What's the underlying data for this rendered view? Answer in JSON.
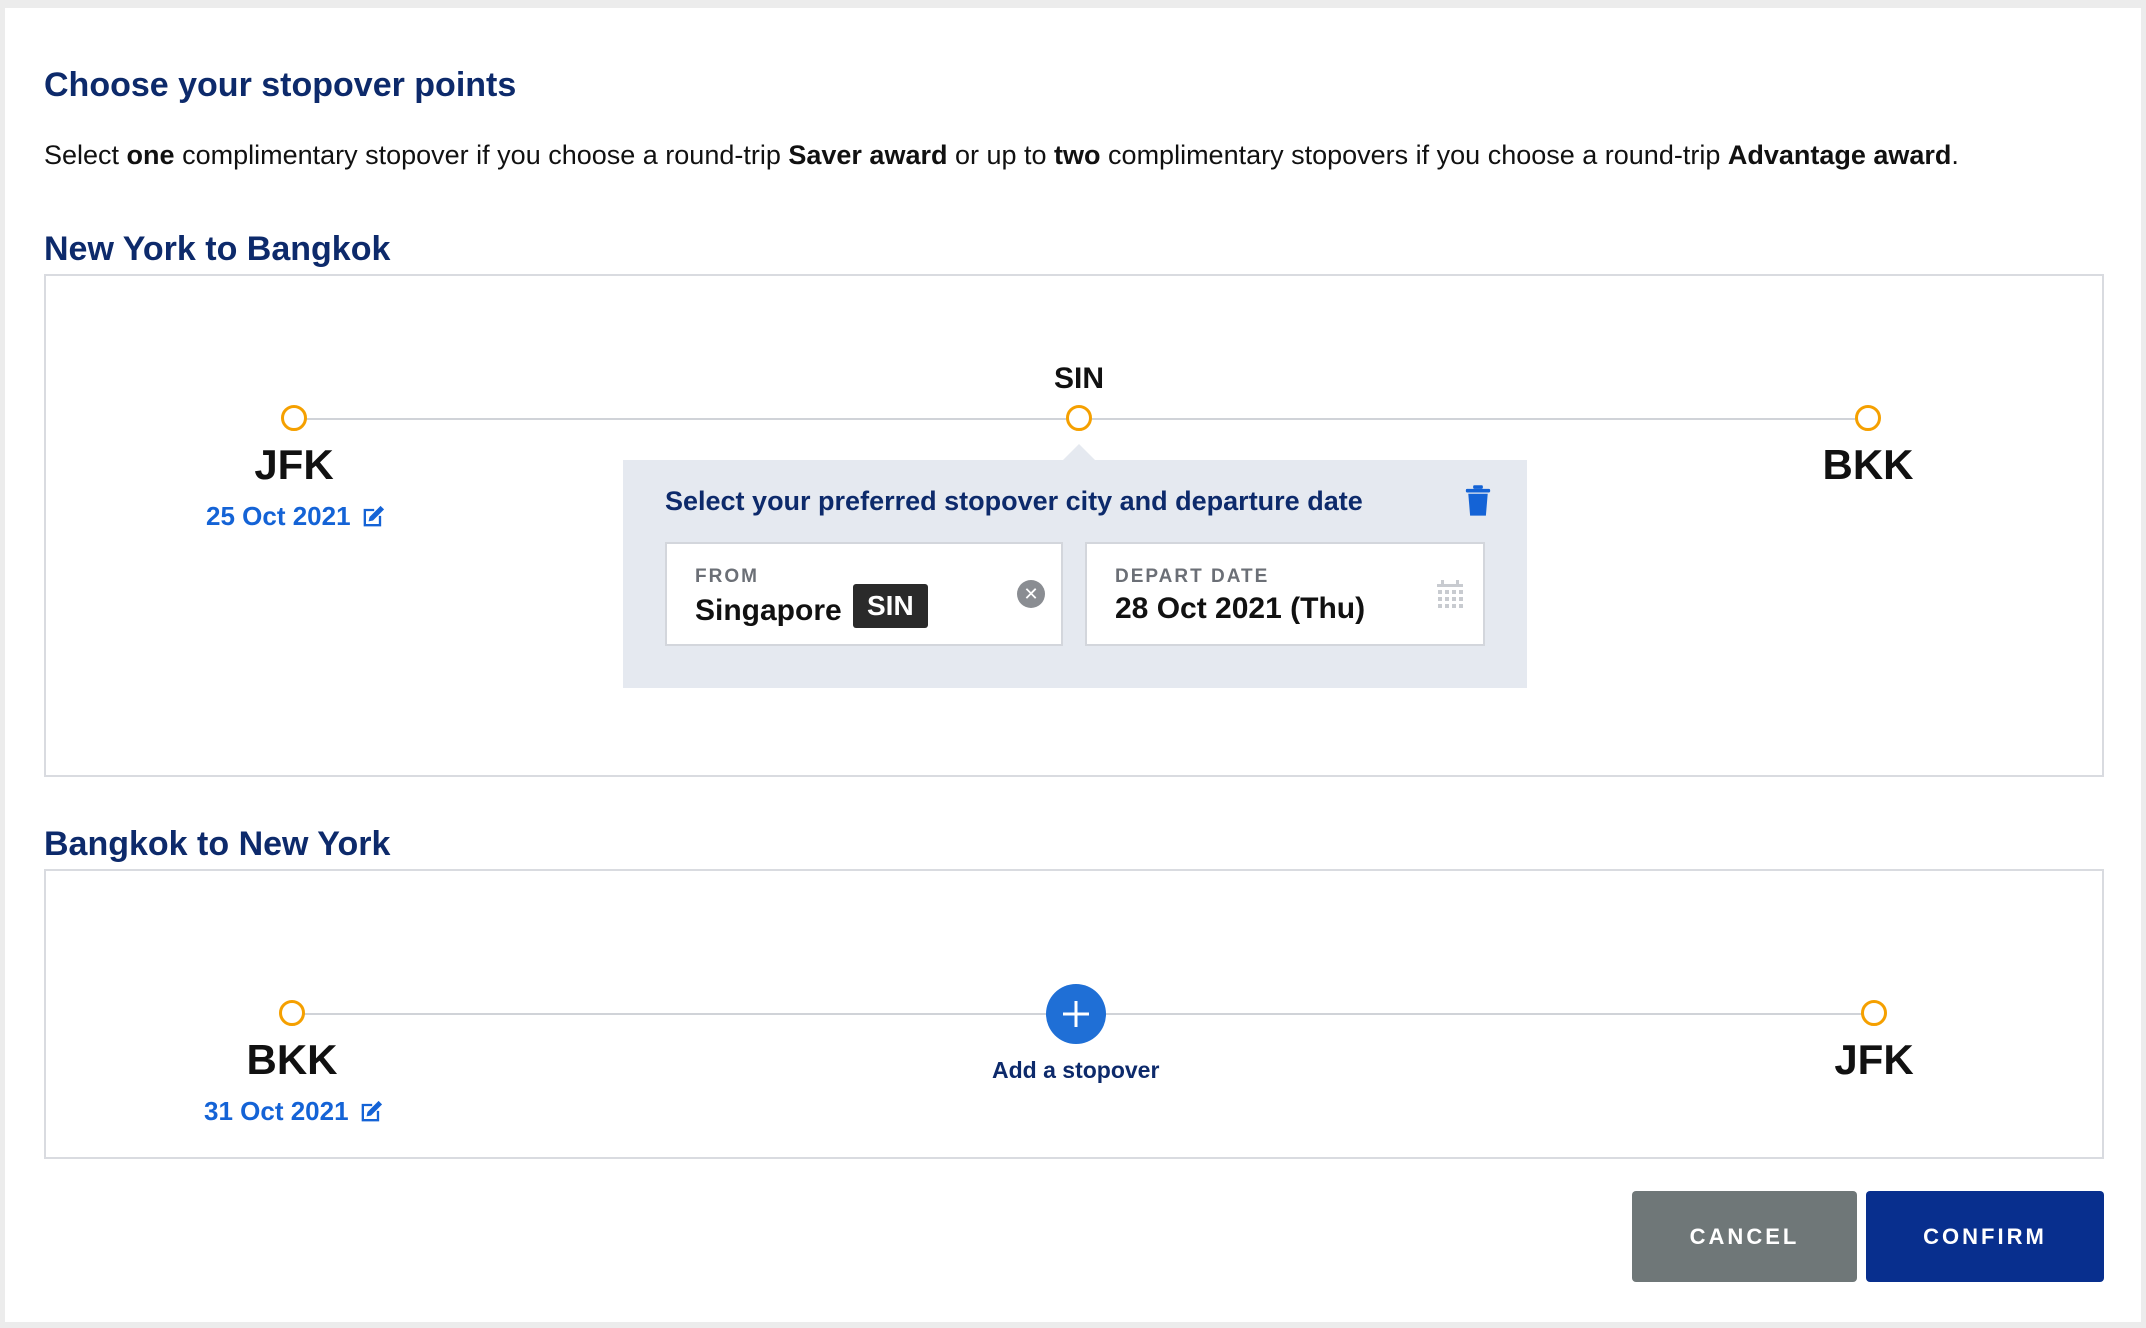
{
  "heading": "Choose your stopover points",
  "intro": {
    "p1": "Select ",
    "b1": "one",
    "p2": " complimentary stopover if you choose a round-trip ",
    "b2": "Saver award",
    "p3": " or up to ",
    "b3": "two",
    "p4": " complimentary stopovers if you choose a round-trip ",
    "b4": "Advantage award",
    "p5": "."
  },
  "outbound": {
    "title": "New York to Bangkok",
    "origin": {
      "code": "JFK",
      "date": "25 Oct 2021"
    },
    "stopover": {
      "code": "SIN"
    },
    "destination": {
      "code": "BKK"
    },
    "popup": {
      "title": "Select your preferred stopover city and departure date",
      "from_label": "FROM",
      "from_city": "Singapore",
      "from_code": "SIN",
      "depart_label": "DEPART DATE",
      "depart_value": "28 Oct 2021 (Thu)"
    }
  },
  "inbound": {
    "title": "Bangkok to New York",
    "origin": {
      "code": "BKK",
      "date": "31 Oct 2021"
    },
    "add_stopover_label": "Add a stopover",
    "destination": {
      "code": "JFK"
    }
  },
  "buttons": {
    "cancel": "CANCEL",
    "confirm": "CONFIRM"
  },
  "colors": {
    "navy": "#0d2a6b",
    "link_blue": "#1463d6",
    "node_orange": "#f5a000",
    "confirm_bg": "#082f8e",
    "cancel_bg": "#6f7778",
    "popup_bg": "#e5e9f0"
  },
  "icons": {
    "edit": "edit-icon",
    "delete": "trash-icon",
    "clear": "clear-icon",
    "calendar": "calendar-icon",
    "add": "plus-icon"
  }
}
